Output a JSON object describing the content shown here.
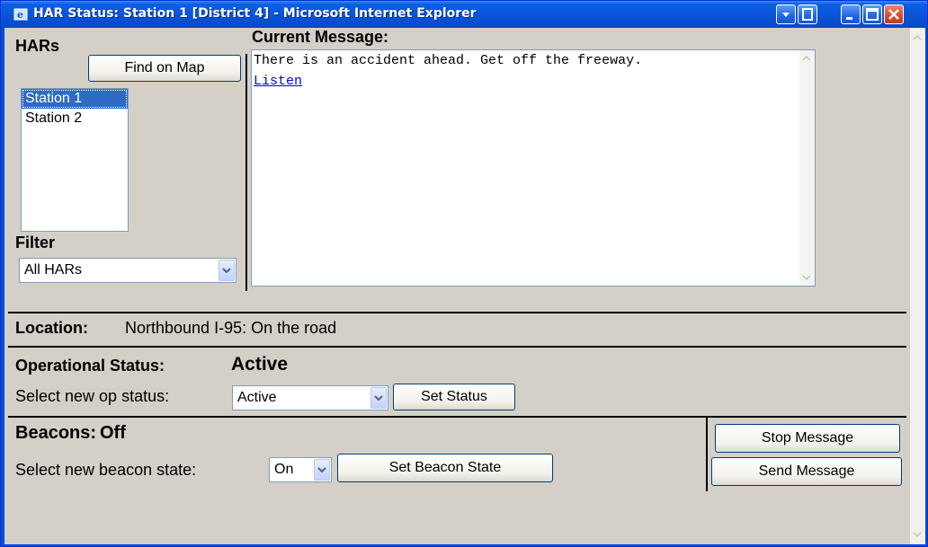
{
  "window": {
    "title": "HAR Status: Station 1 [District 4] - Microsoft Internet Explorer"
  },
  "hars": {
    "heading": "HARs",
    "find_on_map": "Find on Map",
    "stations": [
      "Station 1",
      "Station 2"
    ],
    "selected": "Station 1",
    "filter_label": "Filter",
    "filter_value": "All HARs"
  },
  "message": {
    "heading": "Current Message:",
    "text": "There is an accident ahead. Get off the freeway.",
    "listen_link": "Listen"
  },
  "location": {
    "label": "Location:",
    "value": "Northbound I-95: On the road"
  },
  "operational": {
    "label": "Operational Status:",
    "status": "Active",
    "select_label": "Select new op status:",
    "select_value": "Active",
    "button": "Set Status"
  },
  "beacons": {
    "label": "Beacons:",
    "state": "Off",
    "select_label": "Select new beacon state:",
    "select_value": "On",
    "button": "Set Beacon State"
  },
  "actions": {
    "stop": "Stop Message",
    "send": "Send Message"
  }
}
